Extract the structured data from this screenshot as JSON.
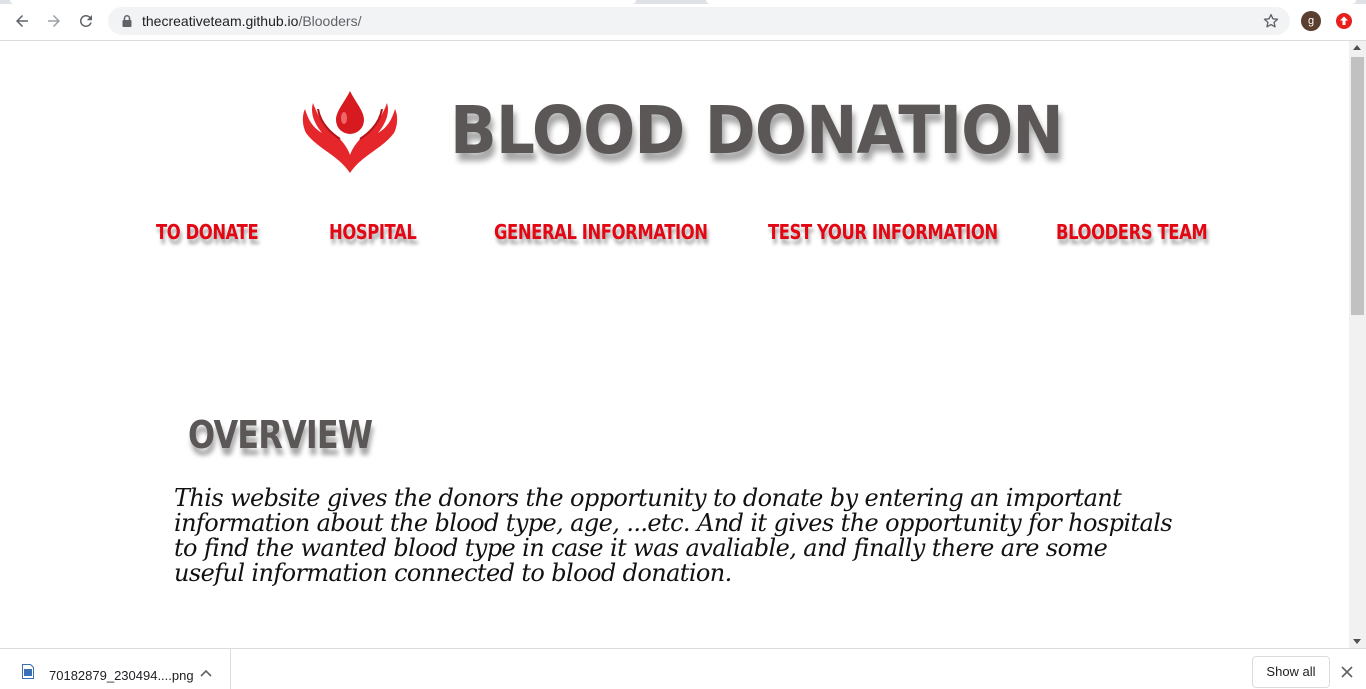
{
  "browser": {
    "url_domain": "thecreativeteam.github.io",
    "url_path": "/Blooders/",
    "avatar_letter": "g",
    "icons": [
      "back-icon",
      "forward-icon",
      "reload-icon",
      "lock-icon",
      "star-icon",
      "extension-icon"
    ]
  },
  "site": {
    "title": "BLOOD DONATION",
    "nav": [
      {
        "label": "TO DONATE"
      },
      {
        "label": "HOSPITAL"
      },
      {
        "label": "GENERAL INFORMATION"
      },
      {
        "label": "TEST YOUR INFORMATION"
      },
      {
        "label": "BLOODERS TEAM"
      }
    ],
    "overview": {
      "heading": "OVERVIEW",
      "text": "This website gives the donors the opportunity to donate by entering an important information about the blood type, age, ...etc. And it gives the opportunity for hospitals to find the wanted blood type in case it was avaliable, and finally there are some useful information connected to blood donation."
    },
    "colors": {
      "title": "#5c5757",
      "nav": "#e30613",
      "logo": "#d71920"
    }
  },
  "downloads": {
    "file_name": "70182879_230494....png",
    "show_all_label": "Show all"
  }
}
